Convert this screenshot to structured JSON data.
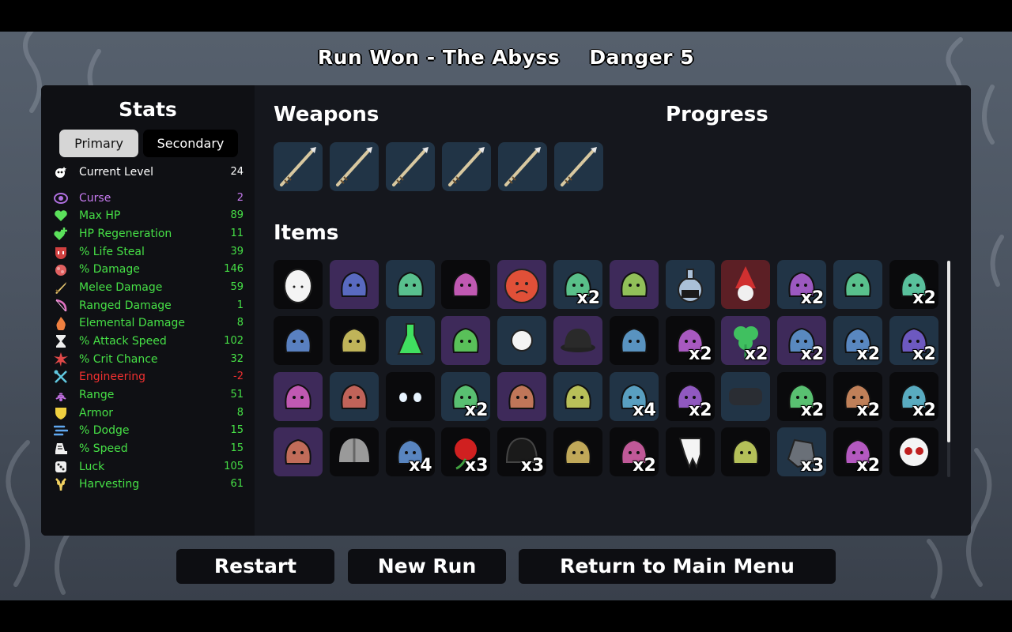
{
  "header": {
    "run_result": "Run Won - The Abyss",
    "danger": "Danger 5"
  },
  "stats": {
    "title": "Stats",
    "tabs": {
      "primary": "Primary",
      "secondary": "Secondary"
    },
    "current_level": {
      "label": "Current Level",
      "value": "24",
      "color": "#ffffff"
    },
    "rows": [
      {
        "label": "Curse",
        "value": "2",
        "color": "#c77bf0",
        "icon": "curse-icon"
      },
      {
        "label": "Max HP",
        "value": "89",
        "color": "#46e046",
        "icon": "heart-icon"
      },
      {
        "label": "HP Regeneration",
        "value": "11",
        "color": "#46e046",
        "icon": "regen-icon"
      },
      {
        "label": "% Life Steal",
        "value": "39",
        "color": "#46e046",
        "icon": "life-steal-icon"
      },
      {
        "label": "% Damage",
        "value": "146",
        "color": "#46e046",
        "icon": "damage-icon"
      },
      {
        "label": "Melee Damage",
        "value": "59",
        "color": "#46e046",
        "icon": "melee-icon"
      },
      {
        "label": "Ranged Damage",
        "value": "1",
        "color": "#46e046",
        "icon": "ranged-icon"
      },
      {
        "label": "Elemental Damage",
        "value": "8",
        "color": "#46e046",
        "icon": "elemental-icon"
      },
      {
        "label": "% Attack Speed",
        "value": "102",
        "color": "#46e046",
        "icon": "attack-speed-icon"
      },
      {
        "label": "% Crit Chance",
        "value": "32",
        "color": "#46e046",
        "icon": "crit-icon"
      },
      {
        "label": "Engineering",
        "value": "-2",
        "color": "#f03030",
        "icon": "engineering-icon"
      },
      {
        "label": "Range",
        "value": "51",
        "color": "#46e046",
        "icon": "range-icon"
      },
      {
        "label": "Armor",
        "value": "8",
        "color": "#46e046",
        "icon": "armor-icon"
      },
      {
        "label": "% Dodge",
        "value": "15",
        "color": "#46e046",
        "icon": "dodge-icon"
      },
      {
        "label": "% Speed",
        "value": "15",
        "color": "#46e046",
        "icon": "speed-icon"
      },
      {
        "label": "Luck",
        "value": "105",
        "color": "#46e046",
        "icon": "luck-icon"
      },
      {
        "label": "Harvesting",
        "value": "61",
        "color": "#46e046",
        "icon": "harvesting-icon"
      }
    ]
  },
  "weapons": {
    "title": "Weapons",
    "slots": [
      {
        "icon": "spear-icon",
        "tier": "2"
      },
      {
        "icon": "spear-icon",
        "tier": "2"
      },
      {
        "icon": "spear-icon",
        "tier": "2"
      },
      {
        "icon": "spear-icon",
        "tier": "2"
      },
      {
        "icon": "spear-icon",
        "tier": "2"
      },
      {
        "icon": "spear-icon",
        "tier": "2"
      }
    ]
  },
  "progress": {
    "title": "Progress"
  },
  "items": {
    "title": "Items",
    "slots": [
      {
        "icon": "egg-icon",
        "tier": "1",
        "qty": ""
      },
      {
        "icon": "ghost-lantern-icon",
        "tier": "3",
        "qty": ""
      },
      {
        "icon": "eyepatch-icon",
        "tier": "2",
        "qty": ""
      },
      {
        "icon": "whistle-icon",
        "tier": "1",
        "qty": ""
      },
      {
        "icon": "sad-tomato-icon",
        "tier": "3",
        "qty": ""
      },
      {
        "icon": "tentacle-icon",
        "tier": "2",
        "qty": "x2"
      },
      {
        "icon": "mirror-icon",
        "tier": "3",
        "qty": ""
      },
      {
        "icon": "potion-flask-icon",
        "tier": "2",
        "qty": ""
      },
      {
        "icon": "gnome-icon",
        "tier": "4",
        "qty": ""
      },
      {
        "icon": "red-cape-icon",
        "tier": "2",
        "qty": "x2"
      },
      {
        "icon": "stone-ring-icon",
        "tier": "2",
        "qty": ""
      },
      {
        "icon": "syringe-icon",
        "tier": "1",
        "qty": "x2"
      },
      {
        "icon": "scarf-icon",
        "tier": "1",
        "qty": ""
      },
      {
        "icon": "palm-tree-icon",
        "tier": "1",
        "qty": ""
      },
      {
        "icon": "green-potion-icon",
        "tier": "2",
        "qty": ""
      },
      {
        "icon": "gem-ring-icon",
        "tier": "3",
        "qty": ""
      },
      {
        "icon": "pearl-icon",
        "tier": "2",
        "qty": ""
      },
      {
        "icon": "bowler-hat-icon",
        "tier": "3",
        "qty": ""
      },
      {
        "icon": "fish-icon",
        "tier": "1",
        "qty": ""
      },
      {
        "icon": "moss-rock-icon",
        "tier": "1",
        "qty": "x2"
      },
      {
        "icon": "clover-icon",
        "tier": "3",
        "qty": "x2"
      },
      {
        "icon": "triangle-gem-icon",
        "tier": "3",
        "qty": "x2"
      },
      {
        "icon": "tentacle-arm-icon",
        "tier": "2",
        "qty": "x2"
      },
      {
        "icon": "sponge-icon",
        "tier": "2",
        "qty": "x2"
      },
      {
        "icon": "rope-icon",
        "tier": "3",
        "qty": ""
      },
      {
        "icon": "spyglass-icon",
        "tier": "2",
        "qty": ""
      },
      {
        "icon": "eyes-in-dark-icon",
        "tier": "1",
        "qty": ""
      },
      {
        "icon": "blade-icon",
        "tier": "2",
        "qty": "x2"
      },
      {
        "icon": "rat-icon",
        "tier": "3",
        "qty": ""
      },
      {
        "icon": "brain-icon",
        "tier": "2",
        "qty": ""
      },
      {
        "icon": "key-icon",
        "tier": "2",
        "qty": "x4"
      },
      {
        "icon": "cat-icon",
        "tier": "1",
        "qty": "x2"
      },
      {
        "icon": "stone-slab-icon",
        "tier": "2",
        "qty": ""
      },
      {
        "icon": "larva-icon",
        "tier": "1",
        "qty": "x2"
      },
      {
        "icon": "claw-icon",
        "tier": "1",
        "qty": "x2"
      },
      {
        "icon": "red-branch-icon",
        "tier": "1",
        "qty": "x2"
      },
      {
        "icon": "tools-icon",
        "tier": "3",
        "qty": ""
      },
      {
        "icon": "helmet-icon",
        "tier": "1",
        "qty": ""
      },
      {
        "icon": "cake-icon",
        "tier": "1",
        "qty": "x4"
      },
      {
        "icon": "red-flower-icon",
        "tier": "1",
        "qty": "x3"
      },
      {
        "icon": "beanie-icon",
        "tier": "1",
        "qty": "x3"
      },
      {
        "icon": "scythe-icon",
        "tier": "1",
        "qty": ""
      },
      {
        "icon": "butterfly-icon",
        "tier": "1",
        "qty": "x2"
      },
      {
        "icon": "tooth-icon",
        "tier": "1",
        "qty": ""
      },
      {
        "icon": "hedgehog-icon",
        "tier": "1",
        "qty": ""
      },
      {
        "icon": "rock-icon",
        "tier": "2",
        "qty": "x3"
      },
      {
        "icon": "teddy-bear-icon",
        "tier": "1",
        "qty": "x2"
      },
      {
        "icon": "skull-icon",
        "tier": "1",
        "qty": ""
      }
    ]
  },
  "buttons": {
    "restart": "Restart",
    "new_run": "New Run",
    "main_menu": "Return to Main Menu"
  }
}
